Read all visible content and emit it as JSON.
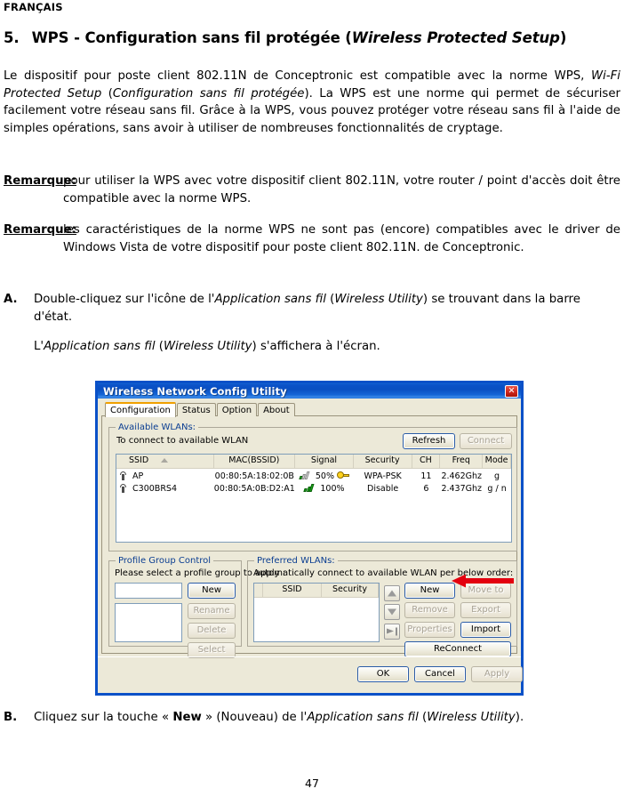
{
  "document": {
    "language_header": "FRANÇAIS",
    "section_number": "5.",
    "section_title_plain": "WPS - Configuration sans fil protégée (",
    "section_title_italic": "Wireless Protected Setup",
    "section_title_close": ")",
    "intro_paragraph_html": "Le dispositif pour poste client 802.11N de Conceptronic est compatible avec la norme WPS, <i>Wi-Fi Protected Setup</i> (<i>Configuration sans fil protégée</i>). La WPS est une norme qui permet de sécuriser facilement votre réseau sans fil. Grâce à la WPS, vous pouvez protéger votre réseau sans fil à l'aide de simples opérations, sans avoir à utiliser de nombreuses fonctionnalités de cryptage.",
    "remark_label": "Remarque:",
    "remark_1_text": "pour utiliser la WPS avec votre dispositif client 802.11N, votre router / point d'accès doit être compatible avec la norme WPS.",
    "remark_2_text": "les caractéristiques de la norme WPS ne sont pas (encore) compatibles avec le driver de Windows Vista de votre dispositif pour poste client 802.11N. de Conceptronic.",
    "step_a_letter": "A.",
    "step_a_html": "Double-cliquez sur l'icône de l'<i>Application sans fil</i> (<i>Wireless Utility</i>) se trouvant dans la barre d'état.",
    "step_a_sub_html": "L'<i>Application sans fil</i> (<i>Wireless Utility</i>) s'affichera à l'écran.",
    "step_b_letter": "B.",
    "step_b_html": "Cliquez sur la touche «&nbsp;<b>New</b>&nbsp;» (Nouveau) de l'<i>Application sans fil</i> (<i>Wireless Utility</i>).",
    "page_number": "47"
  },
  "dialog": {
    "title": "Wireless Network Config Utility",
    "close_label": "✕",
    "tabs": [
      {
        "label": "Configuration",
        "active": true
      },
      {
        "label": "Status",
        "active": false
      },
      {
        "label": "Option",
        "active": false
      },
      {
        "label": "About",
        "active": false
      }
    ],
    "available_wlans": {
      "legend": "Available WLANs:",
      "hint": "To connect to available WLAN",
      "refresh_label": "Refresh",
      "connect_label": "Connect",
      "columns": [
        "SSID",
        "MAC(BSSID)",
        "Signal",
        "Security",
        "CH",
        "Freq",
        "Mode"
      ],
      "rows": [
        {
          "ssid": "AP",
          "mac": "00:80:5A:18:02:0B",
          "signal": "50%",
          "security": "WPA-PSK",
          "ch": "11",
          "freq": "2.462Ghz",
          "mode": "g",
          "secured": true,
          "signal_level": "weak"
        },
        {
          "ssid": "C300BRS4",
          "mac": "00:80:5A:0B:D2:A1",
          "signal": "100%",
          "security": "Disable",
          "ch": "6",
          "freq": "2.437Ghz",
          "mode": "g / n",
          "secured": false,
          "signal_level": "full"
        }
      ]
    },
    "profile_group_control": {
      "legend": "Profile Group Control",
      "hint": "Please select a profile group to apply :",
      "input_value": "",
      "new_label": "New",
      "rename_label": "Rename",
      "delete_label": "Delete",
      "select_label": "Select"
    },
    "preferred_wlans": {
      "legend": "Preferred WLANs:",
      "hint": "Automatically connect to available WLAN per below order:",
      "columns": [
        "SSID",
        "Security"
      ],
      "rows": [],
      "new_label": "New",
      "move_to_label": "Move to",
      "remove_label": "Remove",
      "export_label": "Export",
      "properties_label": "Properties",
      "import_label": "Import",
      "reconnect_label": "ReConnect"
    },
    "footer": {
      "ok_label": "OK",
      "cancel_label": "Cancel",
      "apply_label": "Apply"
    },
    "colors": {
      "titlebar_blue": "#0a51c8",
      "dialog_face": "#ece9d8",
      "group_legend_blue": "#0a3d91",
      "active_tab_accent": "#f0a000",
      "annotation_red": "#e3000f",
      "signal_green": "#18b018"
    }
  }
}
